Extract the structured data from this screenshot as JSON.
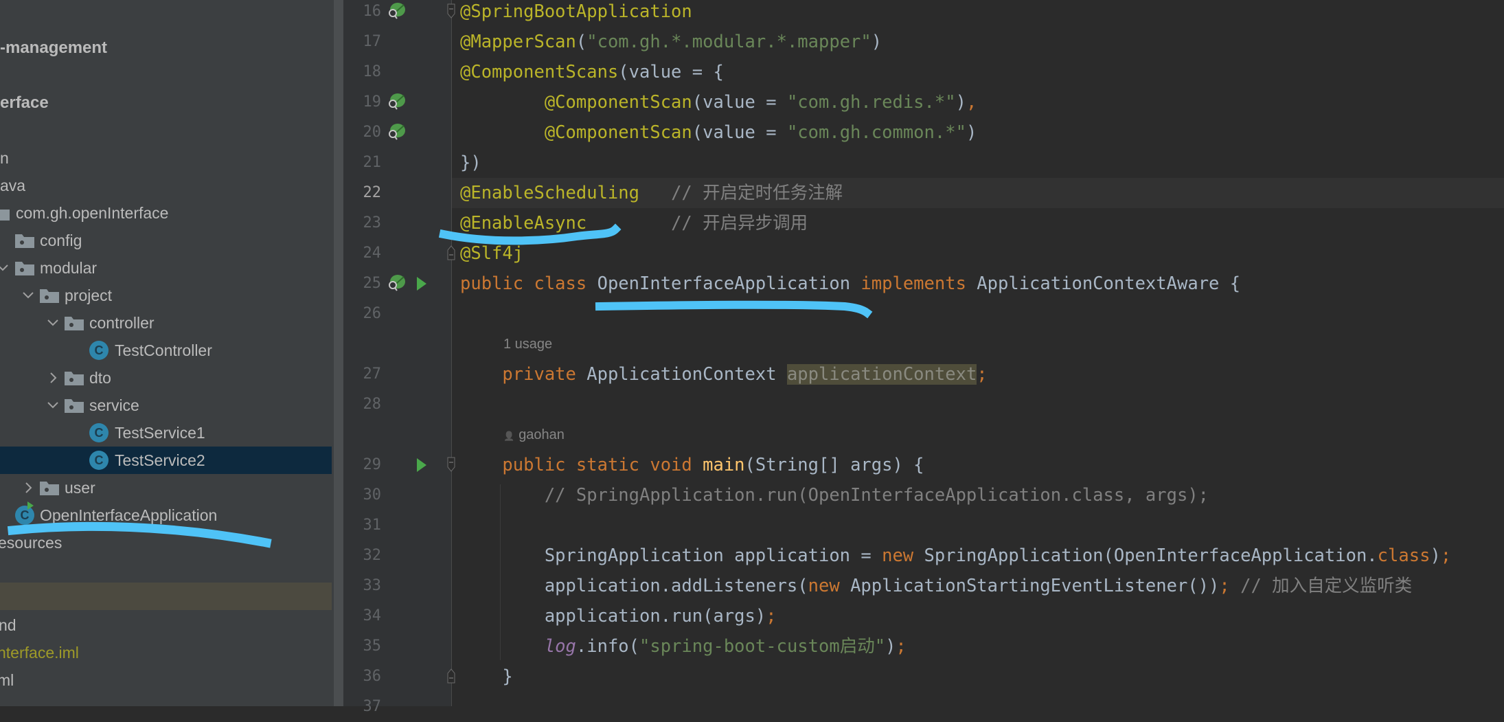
{
  "project_tree": {
    "items": [
      {
        "label": "-management",
        "kind": "text",
        "bold": true
      },
      {
        "label": "erface",
        "kind": "text",
        "bold": true
      },
      {
        "label": "n",
        "kind": "text"
      },
      {
        "label": "ava",
        "kind": "text"
      },
      {
        "label": "com.gh.openInterface",
        "kind": "package"
      },
      {
        "label": "config",
        "kind": "package"
      },
      {
        "label": "modular",
        "kind": "package",
        "expanded": true
      },
      {
        "label": "project",
        "kind": "package",
        "expanded": true
      },
      {
        "label": "controller",
        "kind": "package",
        "expanded": true
      },
      {
        "label": "TestController",
        "kind": "class"
      },
      {
        "label": "dto",
        "kind": "package",
        "expanded": false
      },
      {
        "label": "service",
        "kind": "package",
        "expanded": true
      },
      {
        "label": "TestService1",
        "kind": "class"
      },
      {
        "label": "TestService2",
        "kind": "class",
        "selected": true
      },
      {
        "label": "user",
        "kind": "package",
        "expanded": false
      },
      {
        "label": "OpenInterfaceApplication",
        "kind": "spring-boot-class"
      },
      {
        "label": "esources",
        "kind": "text"
      },
      {
        "label": "nd",
        "kind": "text"
      },
      {
        "label": "nterface.iml",
        "kind": "iml-file"
      },
      {
        "label": "ml",
        "kind": "text"
      }
    ],
    "class_icon_letter": "C"
  },
  "editor": {
    "current_line": "22",
    "lines": [
      {
        "n": "16",
        "bean": true,
        "fold": "start",
        "tokens": [
          {
            "t": "@SpringBootApplication",
            "c": "ann"
          }
        ]
      },
      {
        "n": "17",
        "tokens": [
          {
            "t": "@MapperScan",
            "c": "ann"
          },
          {
            "t": "(",
            "c": ""
          },
          {
            "t": "\"com.gh.*.modular.*.mapper\"",
            "c": "str"
          },
          {
            "t": ")",
            "c": ""
          }
        ]
      },
      {
        "n": "18",
        "tokens": [
          {
            "t": "@ComponentScans",
            "c": "ann"
          },
          {
            "t": "(value = {",
            "c": ""
          }
        ]
      },
      {
        "n": "19",
        "bean": true,
        "tokens": [
          {
            "t": "        ",
            "c": ""
          },
          {
            "t": "@ComponentScan",
            "c": "ann"
          },
          {
            "t": "(value = ",
            "c": ""
          },
          {
            "t": "\"com.gh.redis.*\"",
            "c": "str"
          },
          {
            "t": ")",
            "c": ""
          },
          {
            "t": ",",
            "c": "kw"
          }
        ]
      },
      {
        "n": "20",
        "bean": true,
        "tokens": [
          {
            "t": "        ",
            "c": ""
          },
          {
            "t": "@ComponentScan",
            "c": "ann"
          },
          {
            "t": "(value = ",
            "c": ""
          },
          {
            "t": "\"com.gh.common.*\"",
            "c": "str"
          },
          {
            "t": ")",
            "c": ""
          }
        ]
      },
      {
        "n": "21",
        "tokens": [
          {
            "t": "})",
            "c": ""
          }
        ]
      },
      {
        "n": "22",
        "tokens": [
          {
            "t": "@EnableScheduling",
            "c": "ann"
          },
          {
            "t": "   ",
            "c": ""
          },
          {
            "t": "// 开启定时任务注解",
            "c": "cmt"
          }
        ]
      },
      {
        "n": "23",
        "tokens": [
          {
            "t": "@EnableAsync",
            "c": "ann"
          },
          {
            "t": "        ",
            "c": ""
          },
          {
            "t": "// 开启异步调用",
            "c": "cmt"
          }
        ]
      },
      {
        "n": "24",
        "fold": "end",
        "tokens": [
          {
            "t": "@Slf4j",
            "c": "ann"
          }
        ]
      },
      {
        "n": "25",
        "bean": true,
        "run": true,
        "tokens": [
          {
            "t": "public class ",
            "c": "kw"
          },
          {
            "t": "OpenInterfaceApplication ",
            "c": ""
          },
          {
            "t": "implements ",
            "c": "kw"
          },
          {
            "t": "ApplicationContextAware {",
            "c": ""
          }
        ]
      },
      {
        "n": "26",
        "tokens": []
      },
      {
        "inlay": "1 usage"
      },
      {
        "n": "27",
        "tokens": [
          {
            "t": "    ",
            "c": ""
          },
          {
            "t": "private ",
            "c": "kw"
          },
          {
            "t": "ApplicationContext ",
            "c": ""
          },
          {
            "t": "applicationContext",
            "c": "unused"
          },
          {
            "t": ";",
            "c": "kw"
          }
        ]
      },
      {
        "n": "28",
        "tokens": []
      },
      {
        "inlay": "gaohan",
        "author_icon": "person-icon"
      },
      {
        "n": "29",
        "run": true,
        "fold": "start",
        "tokens": [
          {
            "t": "    ",
            "c": ""
          },
          {
            "t": "public static void ",
            "c": "kw"
          },
          {
            "t": "main",
            "c": "mth"
          },
          {
            "t": "(String[] args) {",
            "c": ""
          }
        ]
      },
      {
        "n": "30",
        "tokens": [
          {
            "t": "        ",
            "c": ""
          },
          {
            "t": "// SpringApplication.run(OpenInterfaceApplication.class, args);",
            "c": "cmt"
          }
        ]
      },
      {
        "n": "31",
        "tokens": []
      },
      {
        "n": "32",
        "tokens": [
          {
            "t": "        SpringApplication application = ",
            "c": ""
          },
          {
            "t": "new ",
            "c": "kw"
          },
          {
            "t": "SpringApplication(OpenInterfaceApplication.",
            "c": ""
          },
          {
            "t": "class",
            "c": "kw"
          },
          {
            "t": ")",
            "c": ""
          },
          {
            "t": ";",
            "c": "kw"
          }
        ]
      },
      {
        "n": "33",
        "tokens": [
          {
            "t": "        application.addListeners(",
            "c": ""
          },
          {
            "t": "new ",
            "c": "kw"
          },
          {
            "t": "ApplicationStartingEventListener())",
            "c": ""
          },
          {
            "t": ";",
            "c": "kw"
          },
          {
            "t": " // 加入自定义监听类",
            "c": "cmt"
          }
        ]
      },
      {
        "n": "34",
        "tokens": [
          {
            "t": "        application.run(args)",
            "c": ""
          },
          {
            "t": ";",
            "c": "kw"
          }
        ]
      },
      {
        "n": "35",
        "tokens": [
          {
            "t": "        ",
            "c": ""
          },
          {
            "t": "log",
            "c": "logi"
          },
          {
            "t": ".info(",
            "c": ""
          },
          {
            "t": "\"spring-boot-custom启动\"",
            "c": "str"
          },
          {
            "t": ")",
            "c": ""
          },
          {
            "t": ";",
            "c": "kw"
          }
        ]
      },
      {
        "n": "36",
        "fold": "end",
        "tokens": [
          {
            "t": "    }",
            "c": ""
          }
        ]
      },
      {
        "n": "37",
        "tokens": []
      }
    ]
  },
  "colors": {
    "annotation": "#bbb529",
    "string": "#6a8759",
    "keyword": "#cc7832",
    "text": "#a9b7c6",
    "comment": "#808080",
    "selection": "#0d293e",
    "marker": "#4fc3f7",
    "run": "#4aa84b"
  }
}
